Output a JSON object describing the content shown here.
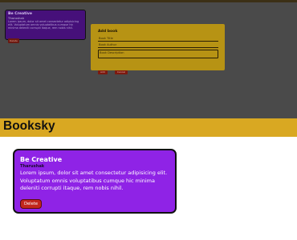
{
  "app": {
    "title": "Booksky"
  },
  "books": [
    {
      "title": "Be Creative",
      "author": "Tharushak",
      "description": "Lorem ipsum, dolor sit amet consectetur adipisicing elit. Voluptatum omnis voluptatibus cumque hic minima deleniti corrupti itaque, rem nobis nihil.",
      "delete_label": "Delete"
    }
  ],
  "modal": {
    "title": "Add book",
    "fields": [
      {
        "value": "Book Title"
      },
      {
        "value": "Book Author"
      },
      {
        "value": "Book Description"
      }
    ],
    "add_label": "Add",
    "cancel_label": "Cancel"
  },
  "colors": {
    "header": "#d9a822",
    "card": "#8f23e6",
    "delete": "#c2271c",
    "modal": "#b79314",
    "overlay": "#4a4a4a"
  }
}
